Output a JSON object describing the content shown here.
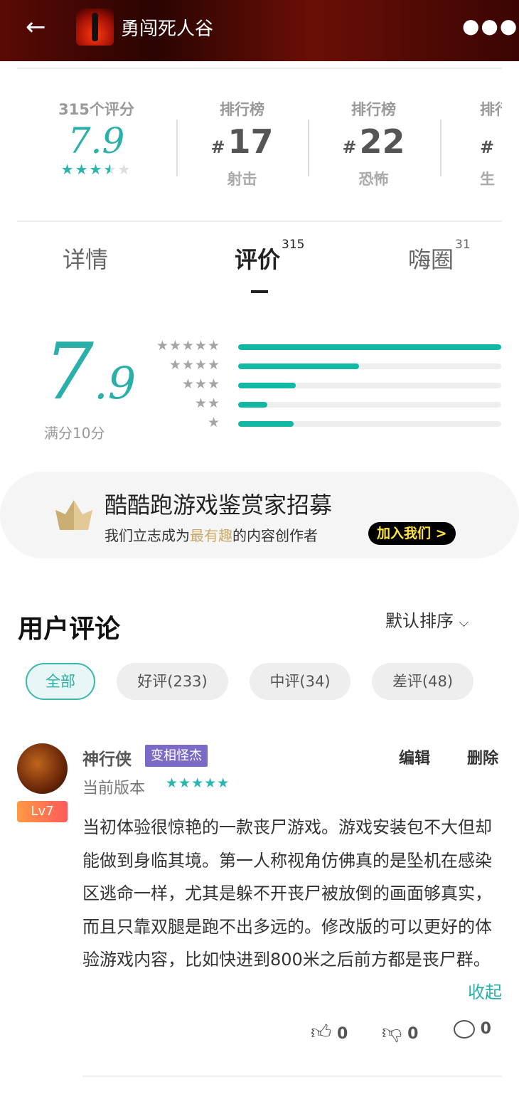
{
  "header": {
    "title": "勇闯死人谷",
    "back_icon": "arrow-left-icon",
    "more_icon": "more-horizontal-icon"
  },
  "stats": [
    {
      "label": "315个评分",
      "score": "7.9",
      "stars": 3.5
    },
    {
      "label": "排行榜",
      "hash": "#",
      "rank": "17",
      "category": "射击"
    },
    {
      "label": "排行榜",
      "hash": "#",
      "rank": "22",
      "category": "恐怖"
    },
    {
      "label": "排行榜",
      "hash": "#",
      "rank": "",
      "category": "生"
    }
  ],
  "tabs": [
    {
      "label": "详情",
      "count": ""
    },
    {
      "label": "评价",
      "count": "315",
      "active": true
    },
    {
      "label": "嗨圈",
      "count": "31"
    }
  ],
  "rating": {
    "score_int": "7",
    "score_dec": ".9",
    "max_label": "满分10分",
    "distribution": [
      {
        "stars": 5,
        "percent": 100
      },
      {
        "stars": 4,
        "percent": 46
      },
      {
        "stars": 3,
        "percent": 22
      },
      {
        "stars": 2,
        "percent": 11
      },
      {
        "stars": 1,
        "percent": 21
      }
    ],
    "bar_color": "#13b8a5"
  },
  "banner": {
    "title": "酷酷跑游戏鉴赏家招募",
    "sub_prefix": "我们立志成为",
    "sub_highlight": "最有趣",
    "sub_suffix": "的内容创作者",
    "button": "加入我们 >"
  },
  "comments_section": {
    "title": "用户评论",
    "sort": "默认排序",
    "filters": [
      {
        "label": "全部",
        "active": true
      },
      {
        "label": "好评(233)"
      },
      {
        "label": "中评(34)"
      },
      {
        "label": "差评(48)"
      }
    ]
  },
  "comment": {
    "user": "神行侠",
    "badge": "变相怪杰",
    "level": "Lv7",
    "version": "当前版本",
    "stars": 5,
    "edit": "编辑",
    "delete": "删除",
    "text": "当初体验很惊艳的一款丧尸游戏。游戏安装包不大但却能做到身临其境。第一人称视角仿佛真的是坠机在感染区逃命一样，尤其是躲不开丧尸被放倒的画面够真实，而且只靠双腿是跑不出多远的。修改版的可以更好的体验游戏内容，比如快进到800米之后前方都是丧尸群。",
    "collapse": "收起",
    "likes": "0",
    "dislikes": "0",
    "replies": "0"
  }
}
